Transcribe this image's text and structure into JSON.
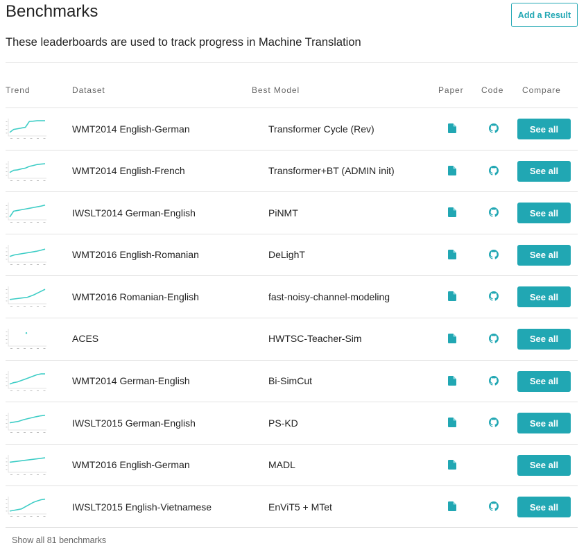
{
  "page": {
    "title": "Benchmarks",
    "subtitle": "These leaderboards are used to track progress in Machine Translation",
    "add_result_label": "Add a Result",
    "show_all_label": "Show all 81 benchmarks"
  },
  "colors": {
    "accent": "#21a7b3",
    "trend_line": "#3ecdc6",
    "text": "#222222",
    "muted": "#666666",
    "divider": "#e2e2e2"
  },
  "icons": {
    "paper": "file-icon",
    "code": "github-icon"
  },
  "table": {
    "columns": {
      "trend": "Trend",
      "dataset": "Dataset",
      "best_model": "Best Model",
      "paper": "Paper",
      "code": "Code",
      "compare": "Compare"
    },
    "see_all_label": "See all",
    "rows": [
      {
        "dataset": "WMT2014 English-German",
        "best_model": "Transformer Cycle (Rev)",
        "has_paper": true,
        "has_code": true,
        "trend": [
          0.15,
          0.35,
          0.4,
          0.45,
          0.5,
          0.9,
          0.92,
          0.95,
          0.95,
          0.95
        ]
      },
      {
        "dataset": "WMT2014 English-French",
        "best_model": "Transformer+BT (ADMIN init)",
        "has_paper": true,
        "has_code": true,
        "trend": [
          0.3,
          0.45,
          0.48,
          0.55,
          0.6,
          0.72,
          0.78,
          0.85,
          0.88,
          0.9
        ]
      },
      {
        "dataset": "IWSLT2014 German-English",
        "best_model": "PiNMT",
        "has_paper": true,
        "has_code": true,
        "trend": [
          0.1,
          0.5,
          0.55,
          0.6,
          0.65,
          0.7,
          0.75,
          0.8,
          0.85,
          0.92
        ]
      },
      {
        "dataset": "WMT2016 English-Romanian",
        "best_model": "DeLighT",
        "has_paper": true,
        "has_code": true,
        "trend": [
          0.3,
          0.4,
          0.45,
          0.5,
          0.55,
          0.6,
          0.65,
          0.72,
          0.8
        ]
      },
      {
        "dataset": "WMT2016 Romanian-English",
        "best_model": "fast-noisy-channel-modeling",
        "has_paper": true,
        "has_code": true,
        "trend": [
          0.2,
          0.25,
          0.3,
          0.35,
          0.5,
          0.7,
          0.9
        ]
      },
      {
        "dataset": "ACES",
        "best_model": "HWTSC-Teacher-Sim",
        "has_paper": true,
        "has_code": true,
        "trend": [
          0.8
        ]
      },
      {
        "dataset": "WMT2014 German-English",
        "best_model": "Bi-SimCut",
        "has_paper": true,
        "has_code": true,
        "trend": [
          0.2,
          0.3,
          0.35,
          0.45,
          0.55,
          0.65,
          0.75,
          0.85,
          0.9,
          0.9
        ]
      },
      {
        "dataset": "IWSLT2015 German-English",
        "best_model": "PS-KD",
        "has_paper": true,
        "has_code": true,
        "trend": [
          0.4,
          0.45,
          0.5,
          0.6,
          0.68,
          0.75,
          0.82,
          0.88,
          0.92
        ]
      },
      {
        "dataset": "WMT2016 English-German",
        "best_model": "MADL",
        "has_paper": true,
        "has_code": false,
        "trend": [
          0.6,
          0.7,
          0.8,
          0.9
        ]
      },
      {
        "dataset": "IWSLT2015 English-Vietnamese",
        "best_model": "EnViT5 + MTet",
        "has_paper": true,
        "has_code": true,
        "trend": [
          0.1,
          0.15,
          0.2,
          0.25,
          0.4,
          0.55,
          0.7,
          0.8,
          0.88,
          0.92
        ]
      }
    ]
  }
}
